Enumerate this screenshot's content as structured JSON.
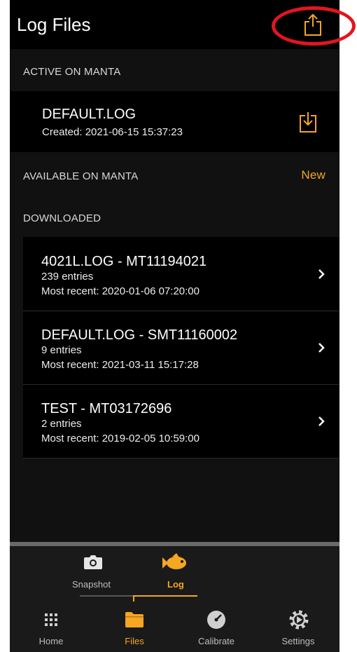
{
  "header": {
    "title": "Log Files"
  },
  "colors": {
    "accent": "#f5a623",
    "annotation": "#e3151f",
    "background": "#111111"
  },
  "sections": {
    "active": {
      "title": "ACTIVE ON MANTA",
      "item": {
        "name": "DEFAULT.LOG",
        "created": "Created: 2021-06-15 15:37:23"
      }
    },
    "available": {
      "title": "AVAILABLE ON MANTA",
      "action": "New"
    },
    "downloaded": {
      "title": "DOWNLOADED",
      "items": [
        {
          "name": "4021L.LOG - MT11194021",
          "entries": "239 entries",
          "recent": "Most recent: 2020-01-06 07:20:00"
        },
        {
          "name": "DEFAULT.LOG - SMT11160002",
          "entries": "9 entries",
          "recent": "Most recent: 2021-03-11 15:17:28"
        },
        {
          "name": "TEST - MT03172696",
          "entries": "2 entries",
          "recent": "Most recent: 2019-02-05 10:59:00"
        }
      ]
    }
  },
  "mode_switch": {
    "options": [
      {
        "label": "Snapshot",
        "icon": "camera-icon",
        "selected": false
      },
      {
        "label": "Log",
        "icon": "fish-icon",
        "selected": true
      }
    ]
  },
  "tabbar": {
    "tabs": [
      {
        "label": "Home",
        "icon": "grid-icon",
        "selected": false
      },
      {
        "label": "Files",
        "icon": "folder-icon",
        "selected": true
      },
      {
        "label": "Calibrate",
        "icon": "gauge-icon",
        "selected": false
      },
      {
        "label": "Settings",
        "icon": "gear-icon",
        "selected": false
      }
    ]
  }
}
